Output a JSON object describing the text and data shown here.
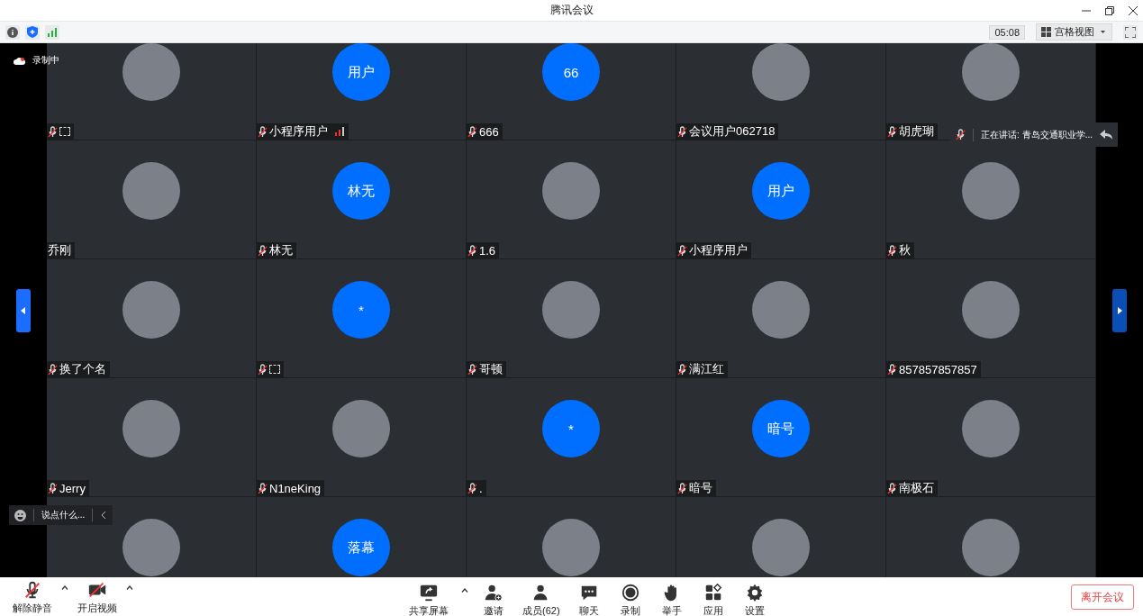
{
  "window": {
    "title": "腾讯会议"
  },
  "info_bar": {
    "timer": "05:08",
    "view_menu": "宫格视图"
  },
  "recording": {
    "label": "录制中"
  },
  "speaking": {
    "label": "正在讲话: 青岛交通职业学..."
  },
  "chat_input": {
    "placeholder": "说点什么..."
  },
  "tiles": [
    {
      "avatar": {
        "kind": "photo"
      },
      "label": {
        "kind": "glyph"
      },
      "muted": true,
      "weak_signal": false
    },
    {
      "avatar": {
        "kind": "initials",
        "text": "用户"
      },
      "label": {
        "kind": "text",
        "text": "小程序用户"
      },
      "muted": true,
      "weak_signal": true
    },
    {
      "avatar": {
        "kind": "initials",
        "text": "66"
      },
      "label": {
        "kind": "text",
        "text": "666"
      },
      "muted": true,
      "weak_signal": false
    },
    {
      "avatar": {
        "kind": "photo"
      },
      "label": {
        "kind": "text",
        "text": "会议用户062718"
      },
      "muted": true,
      "weak_signal": false
    },
    {
      "avatar": {
        "kind": "photo"
      },
      "label": {
        "kind": "text",
        "text": "胡虎瑚"
      },
      "muted": true,
      "weak_signal": false
    },
    {
      "avatar": {
        "kind": "photo"
      },
      "label": {
        "kind": "text",
        "text": "乔刚"
      },
      "muted": false,
      "weak_signal": false
    },
    {
      "avatar": {
        "kind": "initials",
        "text": "林无"
      },
      "label": {
        "kind": "text",
        "text": "林无"
      },
      "muted": true,
      "weak_signal": false
    },
    {
      "avatar": {
        "kind": "photo"
      },
      "label": {
        "kind": "text",
        "text": "1.6"
      },
      "muted": true,
      "weak_signal": false
    },
    {
      "avatar": {
        "kind": "initials",
        "text": "用户"
      },
      "label": {
        "kind": "text",
        "text": "小程序用户"
      },
      "muted": true,
      "weak_signal": false
    },
    {
      "avatar": {
        "kind": "photo"
      },
      "label": {
        "kind": "text",
        "text": "秋"
      },
      "muted": true,
      "weak_signal": false
    },
    {
      "avatar": {
        "kind": "photo"
      },
      "label": {
        "kind": "text",
        "text": "换了个名"
      },
      "muted": true,
      "weak_signal": false
    },
    {
      "avatar": {
        "kind": "initials",
        "text": "*"
      },
      "label": {
        "kind": "glyph"
      },
      "muted": true,
      "weak_signal": false
    },
    {
      "avatar": {
        "kind": "photo"
      },
      "label": {
        "kind": "text",
        "text": "哥顿"
      },
      "muted": true,
      "weak_signal": false
    },
    {
      "avatar": {
        "kind": "photo"
      },
      "label": {
        "kind": "text",
        "text": "满江红"
      },
      "muted": true,
      "weak_signal": false
    },
    {
      "avatar": {
        "kind": "photo"
      },
      "label": {
        "kind": "text",
        "text": "857857857857"
      },
      "muted": true,
      "weak_signal": false
    },
    {
      "avatar": {
        "kind": "photo"
      },
      "label": {
        "kind": "text",
        "text": "Jerry"
      },
      "muted": true,
      "weak_signal": false
    },
    {
      "avatar": {
        "kind": "photo"
      },
      "label": {
        "kind": "text",
        "text": "N1neKing"
      },
      "muted": true,
      "weak_signal": false
    },
    {
      "avatar": {
        "kind": "initials",
        "text": "*"
      },
      "label": {
        "kind": "text",
        "text": "."
      },
      "muted": true,
      "weak_signal": false
    },
    {
      "avatar": {
        "kind": "initials",
        "text": "暗号"
      },
      "label": {
        "kind": "text",
        "text": "暗号"
      },
      "muted": true,
      "weak_signal": false
    },
    {
      "avatar": {
        "kind": "photo"
      },
      "label": {
        "kind": "text",
        "text": "南极石"
      },
      "muted": true,
      "weak_signal": false
    },
    {
      "avatar": {
        "kind": "photo"
      }
    },
    {
      "avatar": {
        "kind": "initials",
        "text": "落幕"
      }
    },
    {
      "avatar": {
        "kind": "photo"
      }
    },
    {
      "avatar": {
        "kind": "photo"
      }
    },
    {
      "avatar": {
        "kind": "photo"
      }
    }
  ],
  "toolbar_left": [
    {
      "label": "解除静音",
      "kind": "mic",
      "caret": true
    },
    {
      "label": "开启视频",
      "kind": "video",
      "caret": true
    }
  ],
  "toolbar_center": [
    {
      "label": "共享屏幕",
      "kind": "share",
      "caret": true
    },
    {
      "label": "邀请",
      "kind": "invite",
      "caret": false
    },
    {
      "label": "成员(62)",
      "kind": "members",
      "caret": false
    },
    {
      "label": "聊天",
      "kind": "chat",
      "caret": false
    },
    {
      "label": "录制",
      "kind": "record",
      "caret": false
    },
    {
      "label": "举手",
      "kind": "hand",
      "caret": false
    },
    {
      "label": "应用",
      "kind": "apps",
      "caret": false
    },
    {
      "label": "设置",
      "kind": "settings",
      "caret": false
    }
  ],
  "leave_button": "离开会议"
}
